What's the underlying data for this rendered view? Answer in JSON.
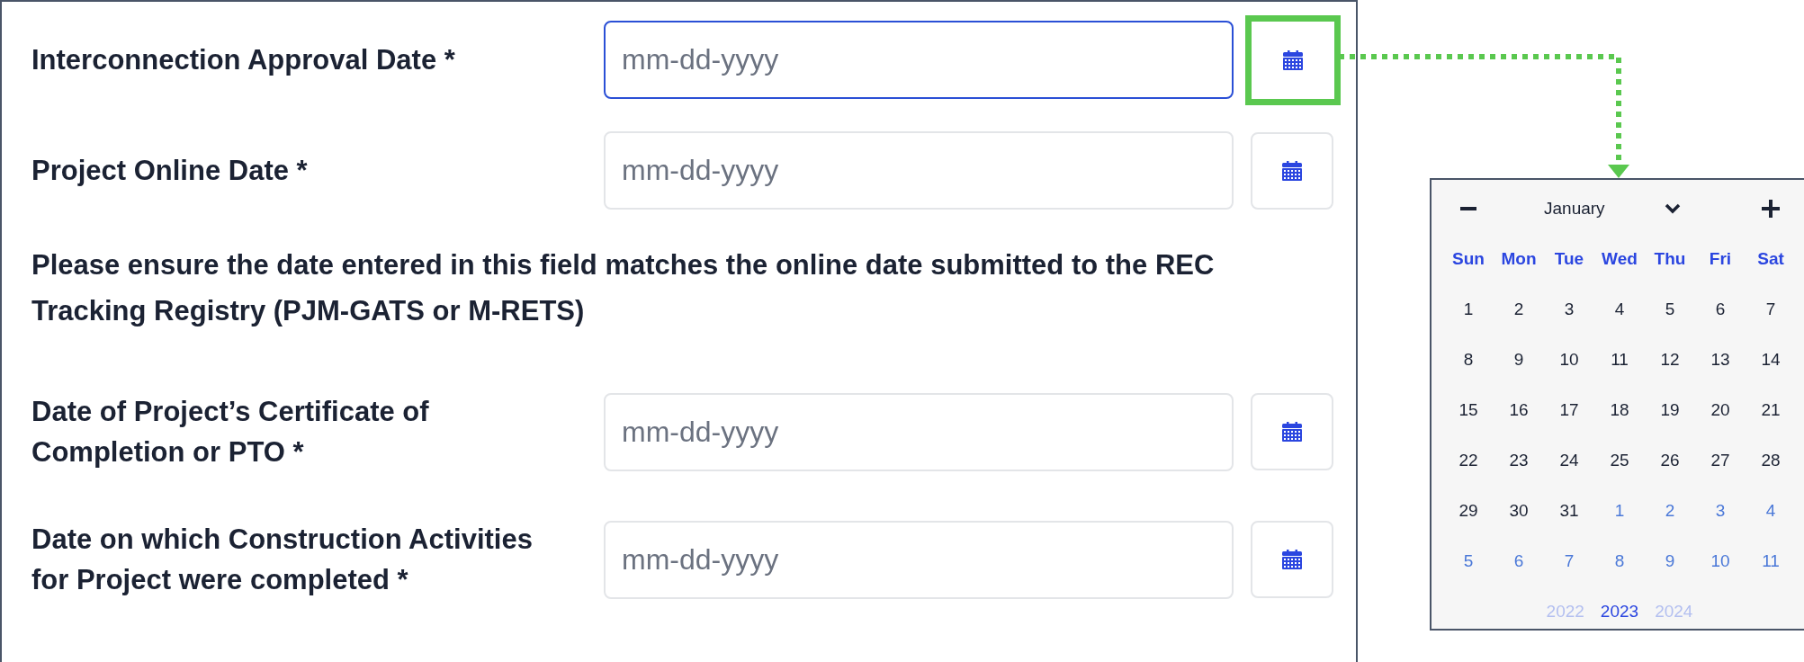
{
  "form": {
    "items": [
      {
        "kind": "date",
        "label": "Interconnection Approval Date *",
        "placeholder": "mm-dd-yyyy",
        "focused": true,
        "highlighted": true
      },
      {
        "kind": "date",
        "label": "Project Online Date *",
        "placeholder": "mm-dd-yyyy",
        "focused": false,
        "highlighted": false
      },
      {
        "kind": "note",
        "text": "Please ensure the date entered in this field matches the online date submitted to the REC Tracking Registry (PJM-GATS or M-RETS)"
      },
      {
        "kind": "date",
        "label": "Date of Project’s Certificate of Completion or PTO *",
        "placeholder": "mm-dd-yyyy",
        "focused": false,
        "highlighted": false
      },
      {
        "kind": "date",
        "label": "Date on which Construction Activities for Project were completed *",
        "placeholder": "mm-dd-yyyy",
        "focused": false,
        "highlighted": false
      }
    ]
  },
  "calendar": {
    "month": "January",
    "weekdays": [
      "Sun",
      "Mon",
      "Tue",
      "Wed",
      "Thu",
      "Fri",
      "Sat"
    ],
    "weeks": [
      [
        {
          "day": "1",
          "other_month": false
        },
        {
          "day": "2",
          "other_month": false
        },
        {
          "day": "3",
          "other_month": false
        },
        {
          "day": "4",
          "other_month": false
        },
        {
          "day": "5",
          "other_month": false
        },
        {
          "day": "6",
          "other_month": false
        },
        {
          "day": "7",
          "other_month": false
        }
      ],
      [
        {
          "day": "8",
          "other_month": false
        },
        {
          "day": "9",
          "other_month": false
        },
        {
          "day": "10",
          "other_month": false
        },
        {
          "day": "11",
          "other_month": false
        },
        {
          "day": "12",
          "other_month": false
        },
        {
          "day": "13",
          "other_month": false
        },
        {
          "day": "14",
          "other_month": false
        }
      ],
      [
        {
          "day": "15",
          "other_month": false
        },
        {
          "day": "16",
          "other_month": false
        },
        {
          "day": "17",
          "other_month": false
        },
        {
          "day": "18",
          "other_month": false
        },
        {
          "day": "19",
          "other_month": false
        },
        {
          "day": "20",
          "other_month": false
        },
        {
          "day": "21",
          "other_month": false
        }
      ],
      [
        {
          "day": "22",
          "other_month": false
        },
        {
          "day": "23",
          "other_month": false
        },
        {
          "day": "24",
          "other_month": false
        },
        {
          "day": "25",
          "other_month": false
        },
        {
          "day": "26",
          "other_month": false
        },
        {
          "day": "27",
          "other_month": false
        },
        {
          "day": "28",
          "other_month": false
        }
      ],
      [
        {
          "day": "29",
          "other_month": false
        },
        {
          "day": "30",
          "other_month": false
        },
        {
          "day": "31",
          "other_month": false
        },
        {
          "day": "1",
          "other_month": true
        },
        {
          "day": "2",
          "other_month": true
        },
        {
          "day": "3",
          "other_month": true
        },
        {
          "day": "4",
          "other_month": true
        }
      ],
      [
        {
          "day": "5",
          "other_month": true
        },
        {
          "day": "6",
          "other_month": true
        },
        {
          "day": "7",
          "other_month": true
        },
        {
          "day": "8",
          "other_month": true
        },
        {
          "day": "9",
          "other_month": true
        },
        {
          "day": "10",
          "other_month": true
        },
        {
          "day": "11",
          "other_month": true
        }
      ]
    ],
    "years": [
      {
        "label": "2022",
        "selected": false
      },
      {
        "label": "2023",
        "selected": true
      },
      {
        "label": "2024",
        "selected": false
      }
    ]
  }
}
